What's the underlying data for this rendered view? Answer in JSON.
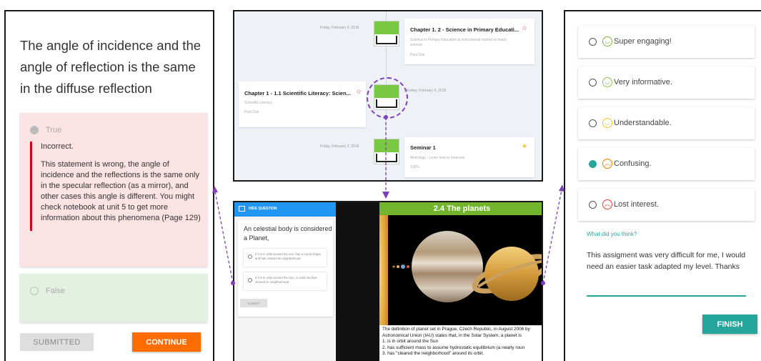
{
  "colors": {
    "accent_purple": "#7e3fb8",
    "incorrect_red": "#d0021b",
    "continue_orange": "#ff6d00",
    "teal": "#26a69a",
    "quiz_blue": "#2196f3",
    "book_green": "#72b52c"
  },
  "left": {
    "question": "The angle of incidence and the angle of reflection is the same in the diffuse reflection",
    "true_label": "True",
    "feedback_title": "Incorrect.",
    "feedback_body": "This statement is wrong, the angle of incidence and the reflections is the same only in the specular reflection (as a mirror), and other cases this angle is different. You might check notebook at unit 5 to get more information about this phenomena (Page 129)",
    "false_label": "False",
    "submitted_label": "SUBMITTED",
    "continue_label": "CONTINUE"
  },
  "timeline": {
    "items": [
      {
        "date": "Friday, February 9, 2018",
        "title": "Chapter 1. 2 - Science in Primary Educati...",
        "sub": "Science in Primary Education & instructional models to teach science",
        "status": "Past Due",
        "star": "☆"
      },
      {
        "date": "Monday, February 5, 2018",
        "title": "Chapter 1 - 1.1 Scientific Literacy: Scien...",
        "sub": "Scientific Literacy",
        "status": "Past Due",
        "star": "☆"
      },
      {
        "date": "Friday, February 2, 2018",
        "title": "Seminar 1",
        "sub": "Metrology - Learn how to measure",
        "status": "100%",
        "star": "★"
      }
    ]
  },
  "quiz": {
    "header": "HIDE QUESTION",
    "question": "An celestial body is considered a Planet,",
    "options": [
      "If it is in orbit around the sun, has a round shape and has cleared its neighborhood",
      "If it is in orbit around the Sun, is solid and has cleared its neighborhood"
    ],
    "submit_label": "SUBMIT"
  },
  "book": {
    "title": "2.4 The  planets",
    "lines": [
      "The definition of planet set in Prague, Czech Republic, in August 2006 by",
      "     Astronomical Union (IAU) states that, in the Solar System, a planet is",
      "1.  is in orbit around the Sun",
      "2.  has sufficient mass to assume hydrostatic equilibrium (a nearly roun",
      "3.  has \"cleared the neighborhood\" around its orbit."
    ]
  },
  "survey": {
    "options": [
      {
        "label": "Super engaging!",
        "face": "◡",
        "color": "#7cb342"
      },
      {
        "label": "Very informative.",
        "face": "◡",
        "color": "#8bc34a"
      },
      {
        "label": "Understandable.",
        "face": "◡",
        "color": "#fbc02d"
      },
      {
        "label": "Confusing.",
        "face": "︵",
        "color": "#f57c00"
      },
      {
        "label": "Lost interest.",
        "face": "︵",
        "color": "#e53935"
      }
    ],
    "selected_index": 3,
    "feedback_label": "What did you think?",
    "feedback_text": "This assigment was very difficult for me, I would need an easier task adapted my level. Thanks",
    "finish_label": "FINISH"
  }
}
